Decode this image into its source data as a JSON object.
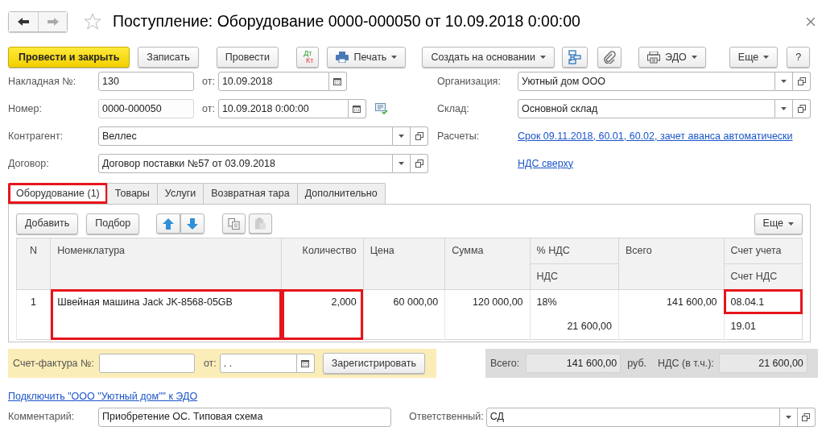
{
  "header": {
    "title": "Поступление: Оборудование 0000-000050 от 10.09.2018 0:00:00"
  },
  "toolbar": [
    {
      "kind": "primary",
      "label": "Провести и закрыть"
    },
    {
      "kind": "button",
      "label": "Записать"
    },
    {
      "kind": "button",
      "label": "Провести"
    },
    {
      "kind": "dtkt",
      "labels": [
        "Дт",
        "Кт"
      ]
    },
    {
      "kind": "menu",
      "label": "Печать"
    },
    {
      "kind": "menu",
      "label": "Создать на основании"
    },
    {
      "kind": "icon"
    },
    {
      "kind": "icon"
    },
    {
      "kind": "menu",
      "label": "ЭДО"
    },
    {
      "kind": "menu",
      "label": "Еще"
    },
    {
      "kind": "button",
      "label": "?"
    }
  ],
  "left_fields": [
    {
      "kind": "number_date",
      "label": "Накладная  №:",
      "value": "130",
      "date_label": "от:",
      "date": "10.09.2018"
    },
    {
      "kind": "number_datetime",
      "label": "Номер:",
      "value": "0000-000050",
      "date_label": "от:",
      "date": "10.09.2018  0:00:00"
    },
    {
      "kind": "select",
      "label": "Контрагент:",
      "value": "Веллес"
    },
    {
      "kind": "select",
      "label": "Договор:",
      "value": "Договор поставки №57 от 03.09.2018"
    }
  ],
  "right_fields": [
    {
      "kind": "select",
      "label": "Организация:",
      "value": "Уютный дом ООО"
    },
    {
      "kind": "select",
      "label": "Склад:",
      "value": "Основной склад"
    },
    {
      "kind": "link",
      "label": "Расчеты:",
      "value": "Срок 09.11.2018, 60.01, 60.02, зачет аванса автоматически"
    },
    {
      "kind": "link",
      "value": "НДС сверху"
    }
  ],
  "tabs": [
    {
      "label": "Оборудование (1)",
      "selected": true,
      "highlighted": true
    },
    {
      "label": "Товары",
      "selected": false,
      "highlighted": false
    },
    {
      "label": "Услуги",
      "selected": false,
      "highlighted": false
    },
    {
      "label": "Возвратная тара",
      "selected": false,
      "highlighted": false
    },
    {
      "label": "Дополнительно",
      "selected": false,
      "highlighted": false
    }
  ],
  "table_toolbar": [
    {
      "kind": "button",
      "label": "Добавить",
      "disabled": false
    },
    {
      "kind": "button",
      "label": "Подбор",
      "disabled": false
    },
    {
      "kind": "icon",
      "disabled": false
    },
    {
      "kind": "icon",
      "disabled": false
    },
    {
      "kind": "icon",
      "disabled": false
    },
    {
      "kind": "icon",
      "disabled": true
    },
    {
      "kind": "menu",
      "label": "Еще",
      "disabled": false
    }
  ],
  "table": {
    "columns": [
      {
        "header": "N"
      },
      {
        "header": "Номенклатура"
      },
      {
        "header": "Количество"
      },
      {
        "header": "Цена"
      },
      {
        "header": "Сумма"
      },
      {
        "header": "% НДС",
        "subheader": "НДС"
      },
      {
        "header": "Всего"
      },
      {
        "header": "Счет учета",
        "subheader": "Счет НДС"
      }
    ],
    "rows": [
      {
        "cells": [
          {
            "text": "1",
            "highlighted": false
          },
          {
            "text": "Швейная машина Jack JK-8568-05GB",
            "highlighted": true
          },
          {
            "text": "2,000",
            "highlighted": true
          },
          {
            "text": "60 000,00",
            "highlighted": false
          },
          {
            "text": "120 000,00",
            "highlighted": false
          },
          {
            "text": "18%",
            "sub": "21 600,00",
            "highlighted": false
          },
          {
            "text": "141 600,00",
            "highlighted": false
          },
          {
            "text": "08.04.1",
            "sub": "19.01",
            "highlighted": true
          }
        ]
      }
    ]
  },
  "invoice": {
    "label": "Счет-фактура №:",
    "date_label": "от:",
    "date": " .  .",
    "button": "Зарегистрировать"
  },
  "totals": {
    "total_label": "Всего:",
    "total": "141 600,00",
    "currency": "руб.",
    "vat_label": "НДС (в т.ч.):",
    "vat": "21 600,00"
  },
  "edo_link": "Подключить \"ООО \"Уютный дом\"\" к ЭДО",
  "comment": {
    "label": "Комментарий:",
    "value": "Приобретение ОС. Типовая схема"
  },
  "responsible": {
    "label": "Ответственный:",
    "value": "СД"
  }
}
